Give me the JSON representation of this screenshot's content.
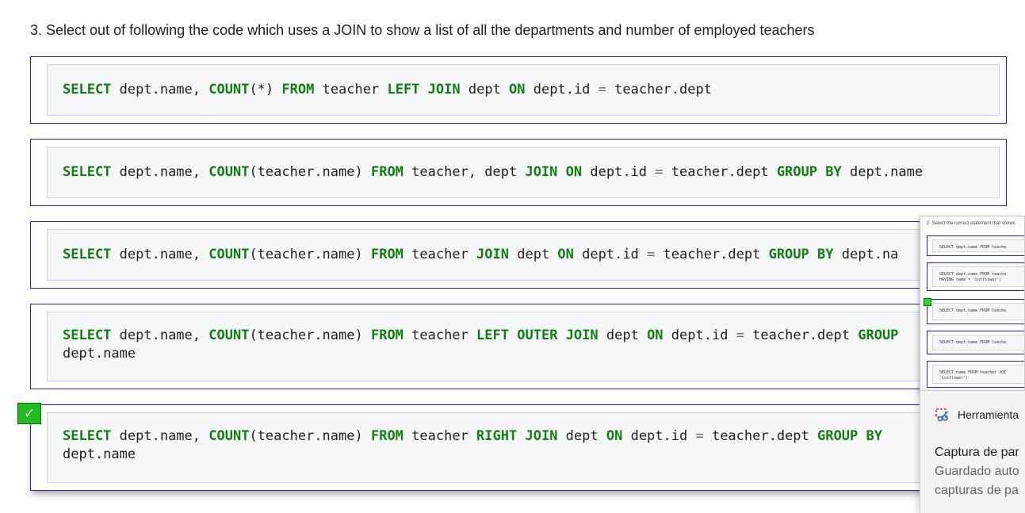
{
  "question": "3. Select out of following the code which uses a JOIN to show a list of all the departments and number of employed teachers",
  "options": [
    {
      "label": "option-1",
      "tokens": [
        {
          "t": "SELECT",
          "k": "kw"
        },
        {
          "t": " dept.name, "
        },
        {
          "t": "COUNT",
          "k": "kw"
        },
        {
          "t": "(*) "
        },
        {
          "t": "FROM",
          "k": "kw"
        },
        {
          "t": " teacher "
        },
        {
          "t": "LEFT",
          "k": "kw"
        },
        {
          "t": " "
        },
        {
          "t": "JOIN",
          "k": "kw"
        },
        {
          "t": " dept "
        },
        {
          "t": "ON",
          "k": "kw"
        },
        {
          "t": " dept.id "
        },
        {
          "t": "=",
          "k": "op"
        },
        {
          "t": " teacher.dept"
        }
      ]
    },
    {
      "label": "option-2",
      "tokens": [
        {
          "t": "SELECT",
          "k": "kw"
        },
        {
          "t": " dept.name, "
        },
        {
          "t": "COUNT",
          "k": "kw"
        },
        {
          "t": "(teacher.name) "
        },
        {
          "t": "FROM",
          "k": "kw"
        },
        {
          "t": " teacher, dept "
        },
        {
          "t": "JOIN",
          "k": "kw"
        },
        {
          "t": " "
        },
        {
          "t": "ON",
          "k": "kw"
        },
        {
          "t": " dept.id "
        },
        {
          "t": "=",
          "k": "op"
        },
        {
          "t": " teacher.dept "
        },
        {
          "t": "GROUP",
          "k": "kw"
        },
        {
          "t": " "
        },
        {
          "t": "BY",
          "k": "kw"
        },
        {
          "t": " dept.name"
        }
      ]
    },
    {
      "label": "option-3",
      "tokens": [
        {
          "t": "SELECT",
          "k": "kw"
        },
        {
          "t": " dept.name, "
        },
        {
          "t": "COUNT",
          "k": "kw"
        },
        {
          "t": "(teacher.name) "
        },
        {
          "t": "FROM",
          "k": "kw"
        },
        {
          "t": " teacher "
        },
        {
          "t": "JOIN",
          "k": "kw"
        },
        {
          "t": " dept "
        },
        {
          "t": "ON",
          "k": "kw"
        },
        {
          "t": " dept.id "
        },
        {
          "t": "=",
          "k": "op"
        },
        {
          "t": " teacher.dept "
        },
        {
          "t": "GROUP",
          "k": "kw"
        },
        {
          "t": " "
        },
        {
          "t": "BY",
          "k": "kw"
        },
        {
          "t": " dept.na"
        }
      ]
    },
    {
      "label": "option-4",
      "tokens": [
        {
          "t": "SELECT",
          "k": "kw"
        },
        {
          "t": " dept.name, "
        },
        {
          "t": "COUNT",
          "k": "kw"
        },
        {
          "t": "(teacher.name) "
        },
        {
          "t": "FROM",
          "k": "kw"
        },
        {
          "t": " teacher "
        },
        {
          "t": "LEFT",
          "k": "kw"
        },
        {
          "t": " "
        },
        {
          "t": "OUTER",
          "k": "kw"
        },
        {
          "t": " "
        },
        {
          "t": "JOIN",
          "k": "kw"
        },
        {
          "t": " dept "
        },
        {
          "t": "ON",
          "k": "kw"
        },
        {
          "t": " dept.id "
        },
        {
          "t": "=",
          "k": "op"
        },
        {
          "t": " teacher.dept "
        },
        {
          "t": "GROUP",
          "k": "kw"
        },
        {
          "t": "\ndept.name"
        }
      ]
    },
    {
      "label": "option-5",
      "tokens": [
        {
          "t": "SELECT",
          "k": "kw"
        },
        {
          "t": " dept.name, "
        },
        {
          "t": "COUNT",
          "k": "kw"
        },
        {
          "t": "(teacher.name) "
        },
        {
          "t": "FROM",
          "k": "kw"
        },
        {
          "t": " teacher "
        },
        {
          "t": "RIGHT",
          "k": "kw"
        },
        {
          "t": " "
        },
        {
          "t": "JOIN",
          "k": "kw"
        },
        {
          "t": " dept "
        },
        {
          "t": "ON",
          "k": "kw"
        },
        {
          "t": " dept.id "
        },
        {
          "t": "=",
          "k": "op"
        },
        {
          "t": " teacher.dept "
        },
        {
          "t": "GROUP",
          "k": "kw"
        },
        {
          "t": " "
        },
        {
          "t": "BY",
          "k": "kw"
        },
        {
          "t": "\ndept.name"
        }
      ]
    }
  ],
  "selected_check": "✓",
  "thumbnail": {
    "question": "2. Select the correct statement that shows",
    "options": [
      "SELECT dept.name FROM teache",
      "SELECT dept.name FROM teache\nHAVING name = 'Cutflower')",
      "SELECT dept.name FROM teache",
      "SELECT dept.name FROM teache",
      "SELECT name FROM teacher JOI\n'Cutflower')"
    ]
  },
  "notification": {
    "app_name": "Herramienta",
    "title": "Captura de par",
    "line1": "Guardado auto",
    "line2": "capturas de pa"
  }
}
